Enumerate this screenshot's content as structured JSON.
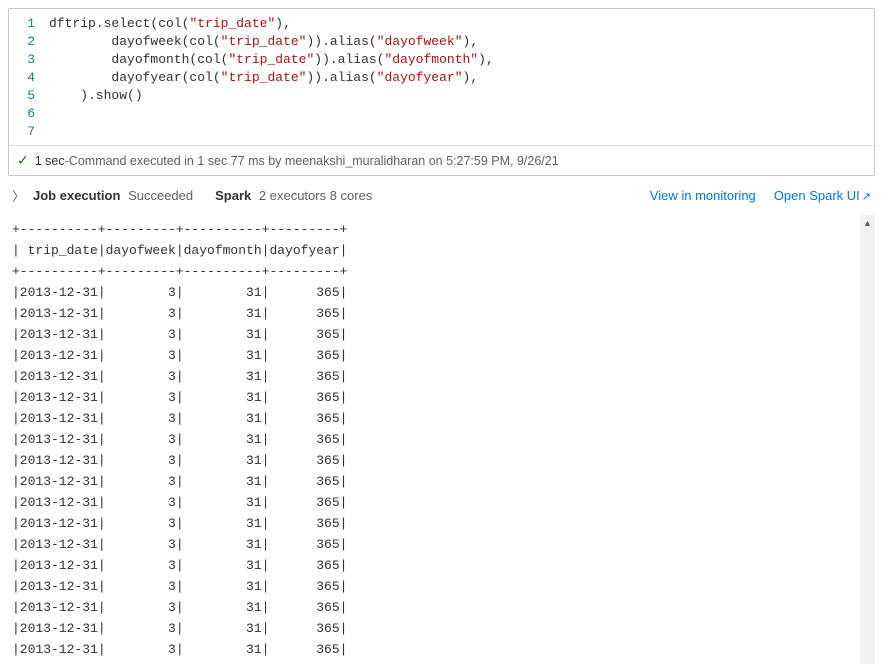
{
  "code": {
    "line_numbers": [
      "1",
      "2",
      "3",
      "4",
      "5",
      "6",
      "7"
    ],
    "l1a": "dftrip.select(col(",
    "l1b": "\"trip_date\"",
    "l1c": "),",
    "l2a": "        dayofweek(col(",
    "l2b": "\"trip_date\"",
    "l2c": ")).alias(",
    "l2d": "\"dayofweek\"",
    "l2e": "),",
    "l3a": "        dayofmonth(col(",
    "l3b": "\"trip_date\"",
    "l3c": ")).alias(",
    "l3d": "\"dayofmonth\"",
    "l3e": "),",
    "l4a": "        dayofyear(col(",
    "l4b": "\"trip_date\"",
    "l4c": ")).alias(",
    "l4d": "\"dayofyear\"",
    "l4e": "),",
    "l5": "    ).show()",
    "l6": "",
    "l7": ""
  },
  "status": {
    "duration": "1 sec",
    "sep": " - ",
    "text": "Command executed in 1 sec 77 ms by meenakshi_muralidharan on 5:27:59 PM, 9/26/21"
  },
  "execbar": {
    "job_label": "Job execution",
    "job_status": "Succeeded",
    "spark_label": "Spark",
    "spark_detail": "2 executors 8 cores",
    "view_link": "View in monitoring",
    "open_link": "Open Spark UI"
  },
  "output": {
    "border": "+----------+---------+----------+---------+",
    "header": "| trip_date|dayofweek|dayofmonth|dayofyear|",
    "rows": [
      "|2013-12-31|        3|        31|      365|",
      "|2013-12-31|        3|        31|      365|",
      "|2013-12-31|        3|        31|      365|",
      "|2013-12-31|        3|        31|      365|",
      "|2013-12-31|        3|        31|      365|",
      "|2013-12-31|        3|        31|      365|",
      "|2013-12-31|        3|        31|      365|",
      "|2013-12-31|        3|        31|      365|",
      "|2013-12-31|        3|        31|      365|",
      "|2013-12-31|        3|        31|      365|",
      "|2013-12-31|        3|        31|      365|",
      "|2013-12-31|        3|        31|      365|",
      "|2013-12-31|        3|        31|      365|",
      "|2013-12-31|        3|        31|      365|",
      "|2013-12-31|        3|        31|      365|",
      "|2013-12-31|        3|        31|      365|",
      "|2013-12-31|        3|        31|      365|",
      "|2013-12-31|        3|        31|      365|"
    ]
  }
}
